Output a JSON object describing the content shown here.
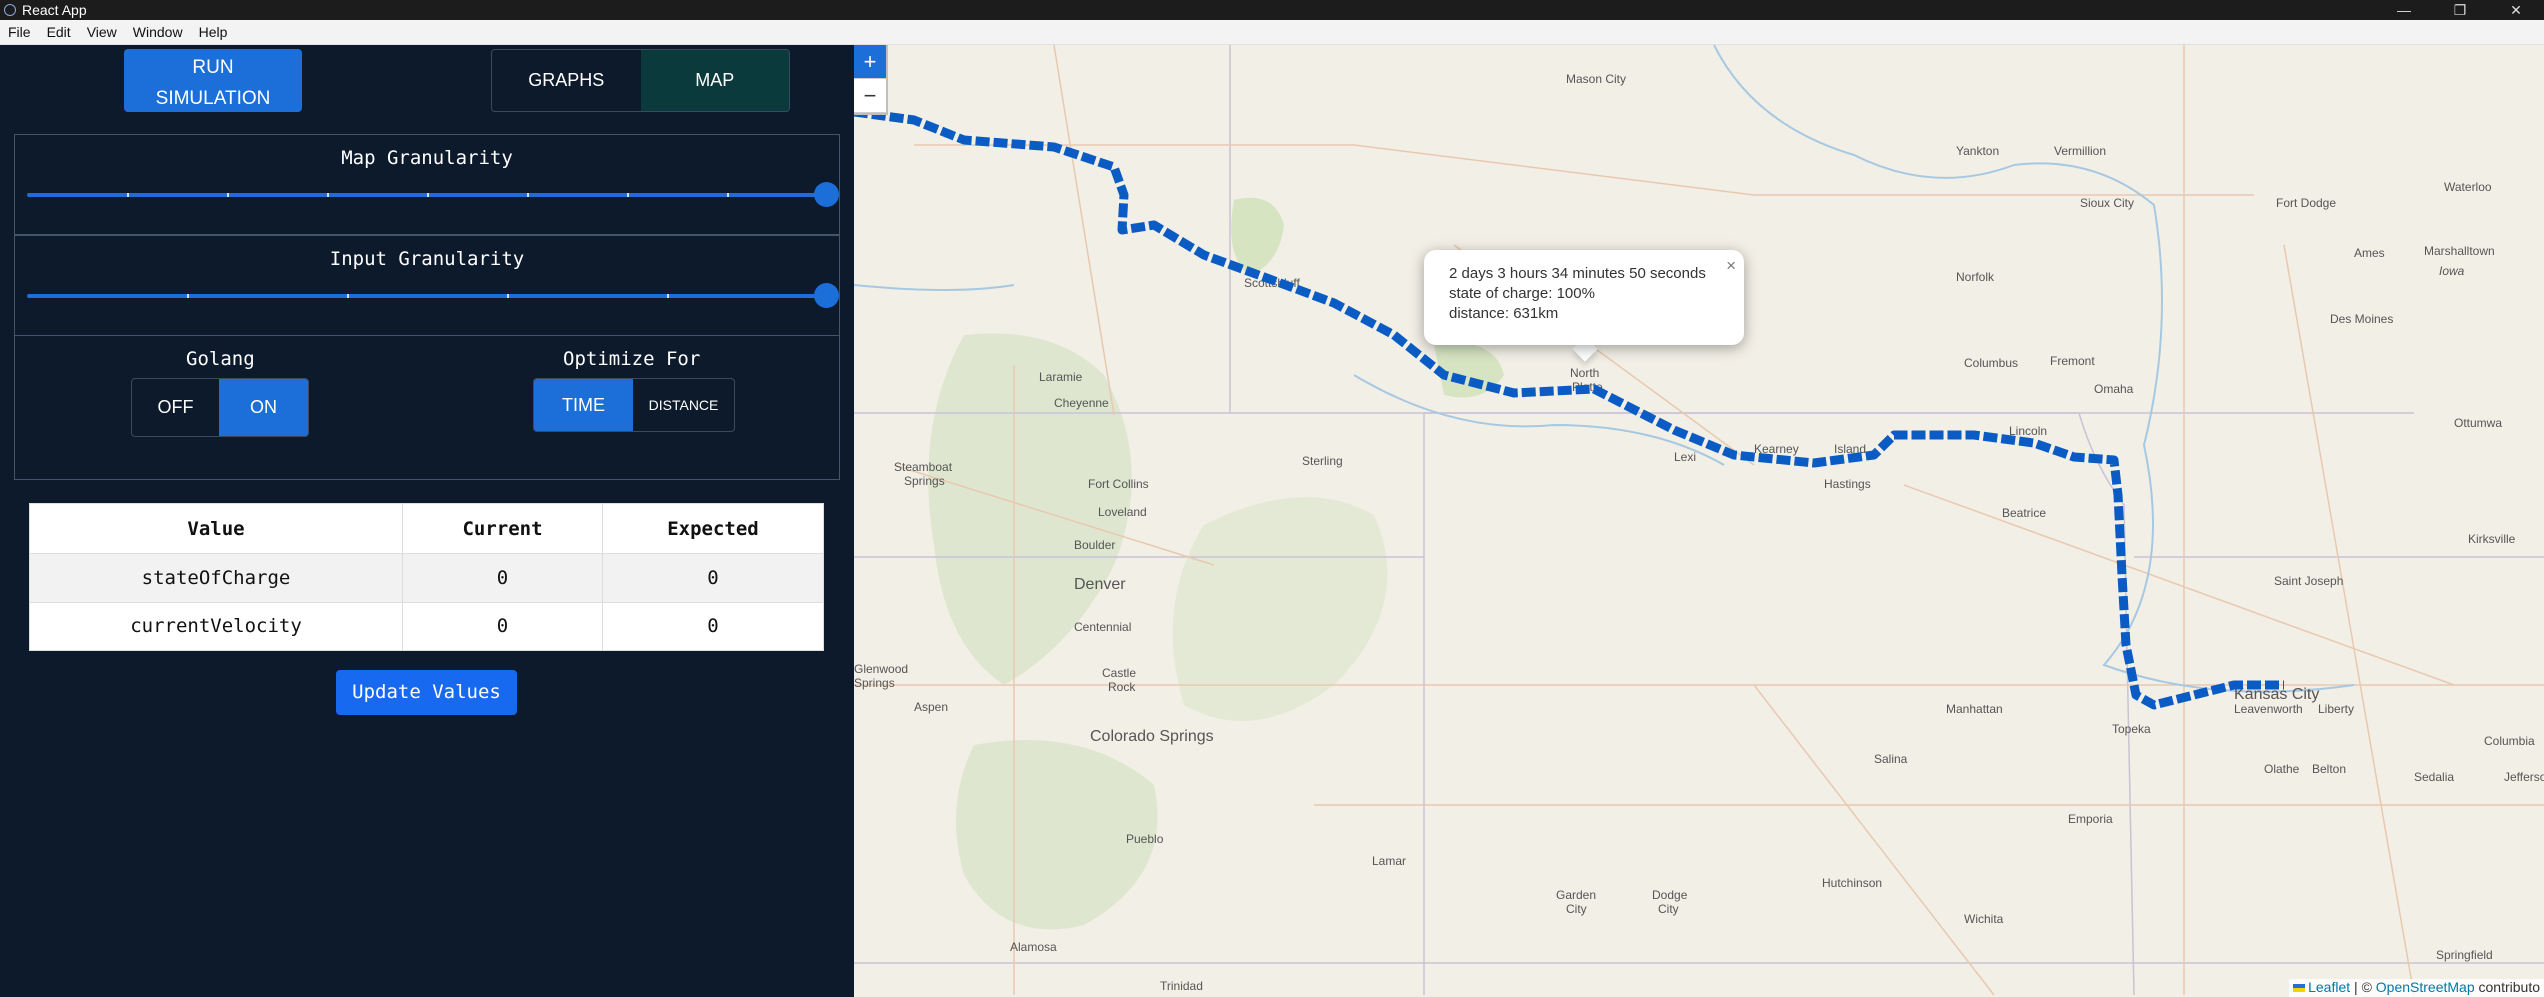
{
  "window": {
    "title": "React App",
    "controls": [
      "—",
      "❐",
      "✕"
    ]
  },
  "menu": [
    "File",
    "Edit",
    "View",
    "Window",
    "Help"
  ],
  "run_button": {
    "label": "RUN SIMULATION"
  },
  "view_toggle": {
    "graphs": "GRAPHS",
    "map": "MAP",
    "active": "MAP"
  },
  "map_granularity": {
    "title": "Map Granularity",
    "value_fraction": 1.0
  },
  "input_granularity": {
    "title": "Input Granularity",
    "value_fraction": 1.0
  },
  "golang": {
    "title": "Golang",
    "off": "OFF",
    "on": "ON",
    "selected": "ON"
  },
  "optimize": {
    "title": "Optimize For",
    "time": "TIME",
    "distance": "DISTANCE",
    "selected": "TIME"
  },
  "table": {
    "headers": [
      "Value",
      "Current",
      "Expected"
    ],
    "rows": [
      {
        "name": "stateOfCharge",
        "current": "0",
        "expected": "0"
      },
      {
        "name": "currentVelocity",
        "current": "0",
        "expected": "0"
      }
    ]
  },
  "update_button": {
    "label": "Update Values"
  },
  "map": {
    "zoom_in": "+",
    "zoom_out": "−",
    "popup": {
      "line1": "2 days 3 hours 34 minutes 50 seconds",
      "line2": "state of charge: 100%",
      "line3": "distance: 631km",
      "close": "×"
    },
    "attribution": {
      "leaflet": "Leaflet",
      "sep": " | © ",
      "osm": "OpenStreetMap",
      "tail": " contributo"
    },
    "route_color": "#0a5bc4",
    "cities": [
      "Mason City",
      "Yankton",
      "Vermillion",
      "Waterloo",
      "Sioux City",
      "Fort Dodge",
      "Ames",
      "Marshalltown",
      "Iowa",
      "Norfolk",
      "Des Moines",
      "Scottsbluff",
      "Columbus",
      "Fremont",
      "Omaha",
      "Ottumwa",
      "Laramie",
      "North Platte",
      "Cheyenne",
      "Lincoln",
      "Kearney",
      "Island",
      "Lexi",
      "Steamboat Springs",
      "Sterling",
      "Hastings",
      "Fort Collins",
      "Loveland",
      "Beatrice",
      "Kirksville",
      "Boulder",
      "Denver",
      "Saint Joseph",
      "Centennial",
      "Glenwood Springs",
      "Aspen",
      "Castle Rock",
      "Manhattan",
      "Leavenworth",
      "Liberty",
      "Kansas City",
      "Columbia",
      "Salina",
      "Topeka",
      "Olathe",
      "Belton",
      "Sedalia",
      "Jefferson City",
      "Colorado Springs",
      "Emporia",
      "Pueblo",
      "Lamar",
      "Hutchinson",
      "Garden City",
      "Dodge City",
      "Wichita",
      "Alamosa",
      "Trinidad",
      "Springfield"
    ]
  }
}
